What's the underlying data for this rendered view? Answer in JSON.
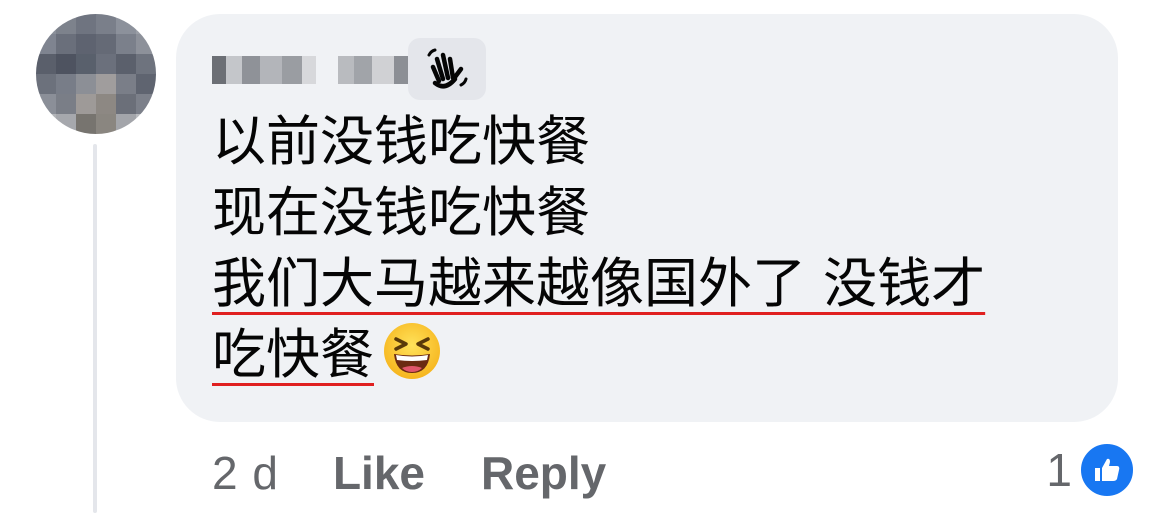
{
  "comment": {
    "lines": [
      "以前没钱吃快餐",
      "现在没钱吃快餐",
      "我们大马越来越像国外了 没钱才",
      "吃快餐"
    ],
    "emoji_name": "grinning-squinting-face-icon",
    "badge_icon": "waving-hand-icon"
  },
  "meta": {
    "time": "2 d",
    "like_label": "Like",
    "reply_label": "Reply"
  },
  "reactions": {
    "count": "1",
    "type": "like-icon"
  },
  "colors": {
    "bubble_bg": "#f0f2f5",
    "meta_text": "#65676b",
    "like_blue": "#1877f2",
    "underline_red": "#e02020"
  }
}
